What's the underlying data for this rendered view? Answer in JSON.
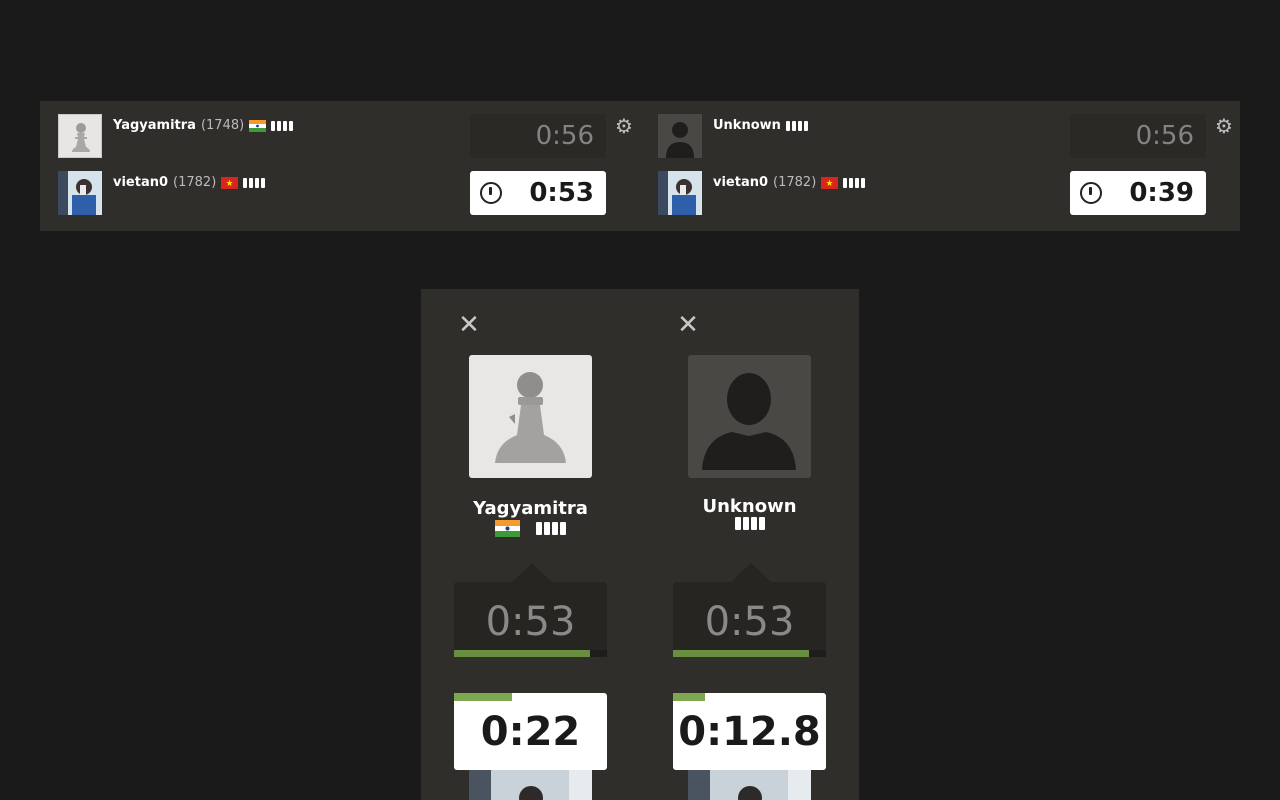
{
  "colors": {
    "background": "#1a1a1a",
    "panel": "#302e2b",
    "clock_inactive": "#2a2926",
    "clock_active": "#ffffff",
    "progress_green": "#7fa650"
  },
  "topbar": {
    "games": [
      {
        "opponent": {
          "name": "Yagyamitra",
          "rating": "(1748)",
          "flag": "india-flag",
          "avatar": "pawn-avatar",
          "clock": "0:56"
        },
        "player": {
          "name": "vietan0",
          "rating": "(1782)",
          "flag": "vietnam-flag",
          "avatar": "user-photo",
          "clock": "0:53"
        },
        "settings_icon": "gear-icon"
      },
      {
        "opponent": {
          "name": "Unknown",
          "rating": "",
          "flag": "",
          "avatar": "silhouette-avatar",
          "clock": "0:56"
        },
        "player": {
          "name": "vietan0",
          "rating": "(1782)",
          "flag": "vietnam-flag",
          "avatar": "user-photo",
          "clock": "0:39"
        },
        "settings_icon": "gear-icon"
      }
    ]
  },
  "panel": {
    "columns": [
      {
        "close_icon": "close-icon",
        "name": "Yagyamitra",
        "flag": "india-flag",
        "avatar": "pawn-avatar",
        "opponent_clock": "0:53",
        "opponent_progress": 0.89,
        "player_clock": "0:22",
        "player_progress": 0.38
      },
      {
        "close_icon": "close-icon",
        "name": "Unknown",
        "flag": "",
        "avatar": "silhouette-avatar",
        "opponent_clock": "0:53",
        "opponent_progress": 0.89,
        "player_clock": "0:12.8",
        "player_progress": 0.21
      }
    ]
  }
}
